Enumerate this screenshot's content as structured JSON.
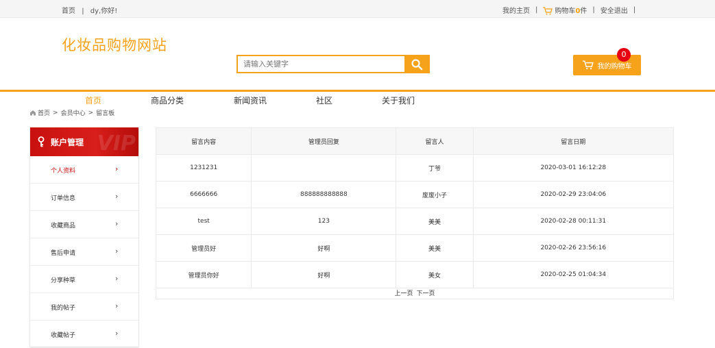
{
  "topbar": {
    "home": "首页",
    "divider": "|",
    "greeting": "dy,你好!",
    "my_home": "我的主页",
    "cart_label": "购物车",
    "cart_count": "0",
    "cart_unit": "件",
    "logout": "安全退出"
  },
  "header": {
    "logo": "化妆品购物网站",
    "search_placeholder": "请输入关键字",
    "cart_button": "我的购物车",
    "cart_badge": "0"
  },
  "nav": [
    "首页",
    "商品分类",
    "新闻资讯",
    "社区",
    "关于我们"
  ],
  "breadcrumb": [
    "首页",
    "会员中心",
    "留言板"
  ],
  "sidebar": {
    "title": "账户管理",
    "vip": "VIP",
    "items": [
      "个人资料",
      "订单信息",
      "收藏商品",
      "售后申请",
      "分享种草",
      "我的帖子",
      "收藏帖子"
    ]
  },
  "table": {
    "headers": [
      "留言内容",
      "管理员回复",
      "留言人",
      "留言日期"
    ],
    "rows": [
      [
        "1231231",
        "",
        "丁爷",
        "2020-03-01 16:12:28"
      ],
      [
        "6666666",
        "888888888888",
        "废废小子",
        "2020-02-29 23:04:06"
      ],
      [
        "test",
        "123",
        "美美",
        "2020-02-28 00:11:31"
      ],
      [
        "管理员好",
        "好啊",
        "美美",
        "2020-02-26 23:56:16"
      ],
      [
        "管理员你好",
        "好啊",
        "美女",
        "2020-02-25 01:04:34"
      ]
    ]
  },
  "pager": {
    "prev": "上一页",
    "next": "下一页"
  },
  "colors": {
    "accent": "#f7a21b",
    "sidebar_red": "#c8110f",
    "badge_red": "#e60012"
  }
}
